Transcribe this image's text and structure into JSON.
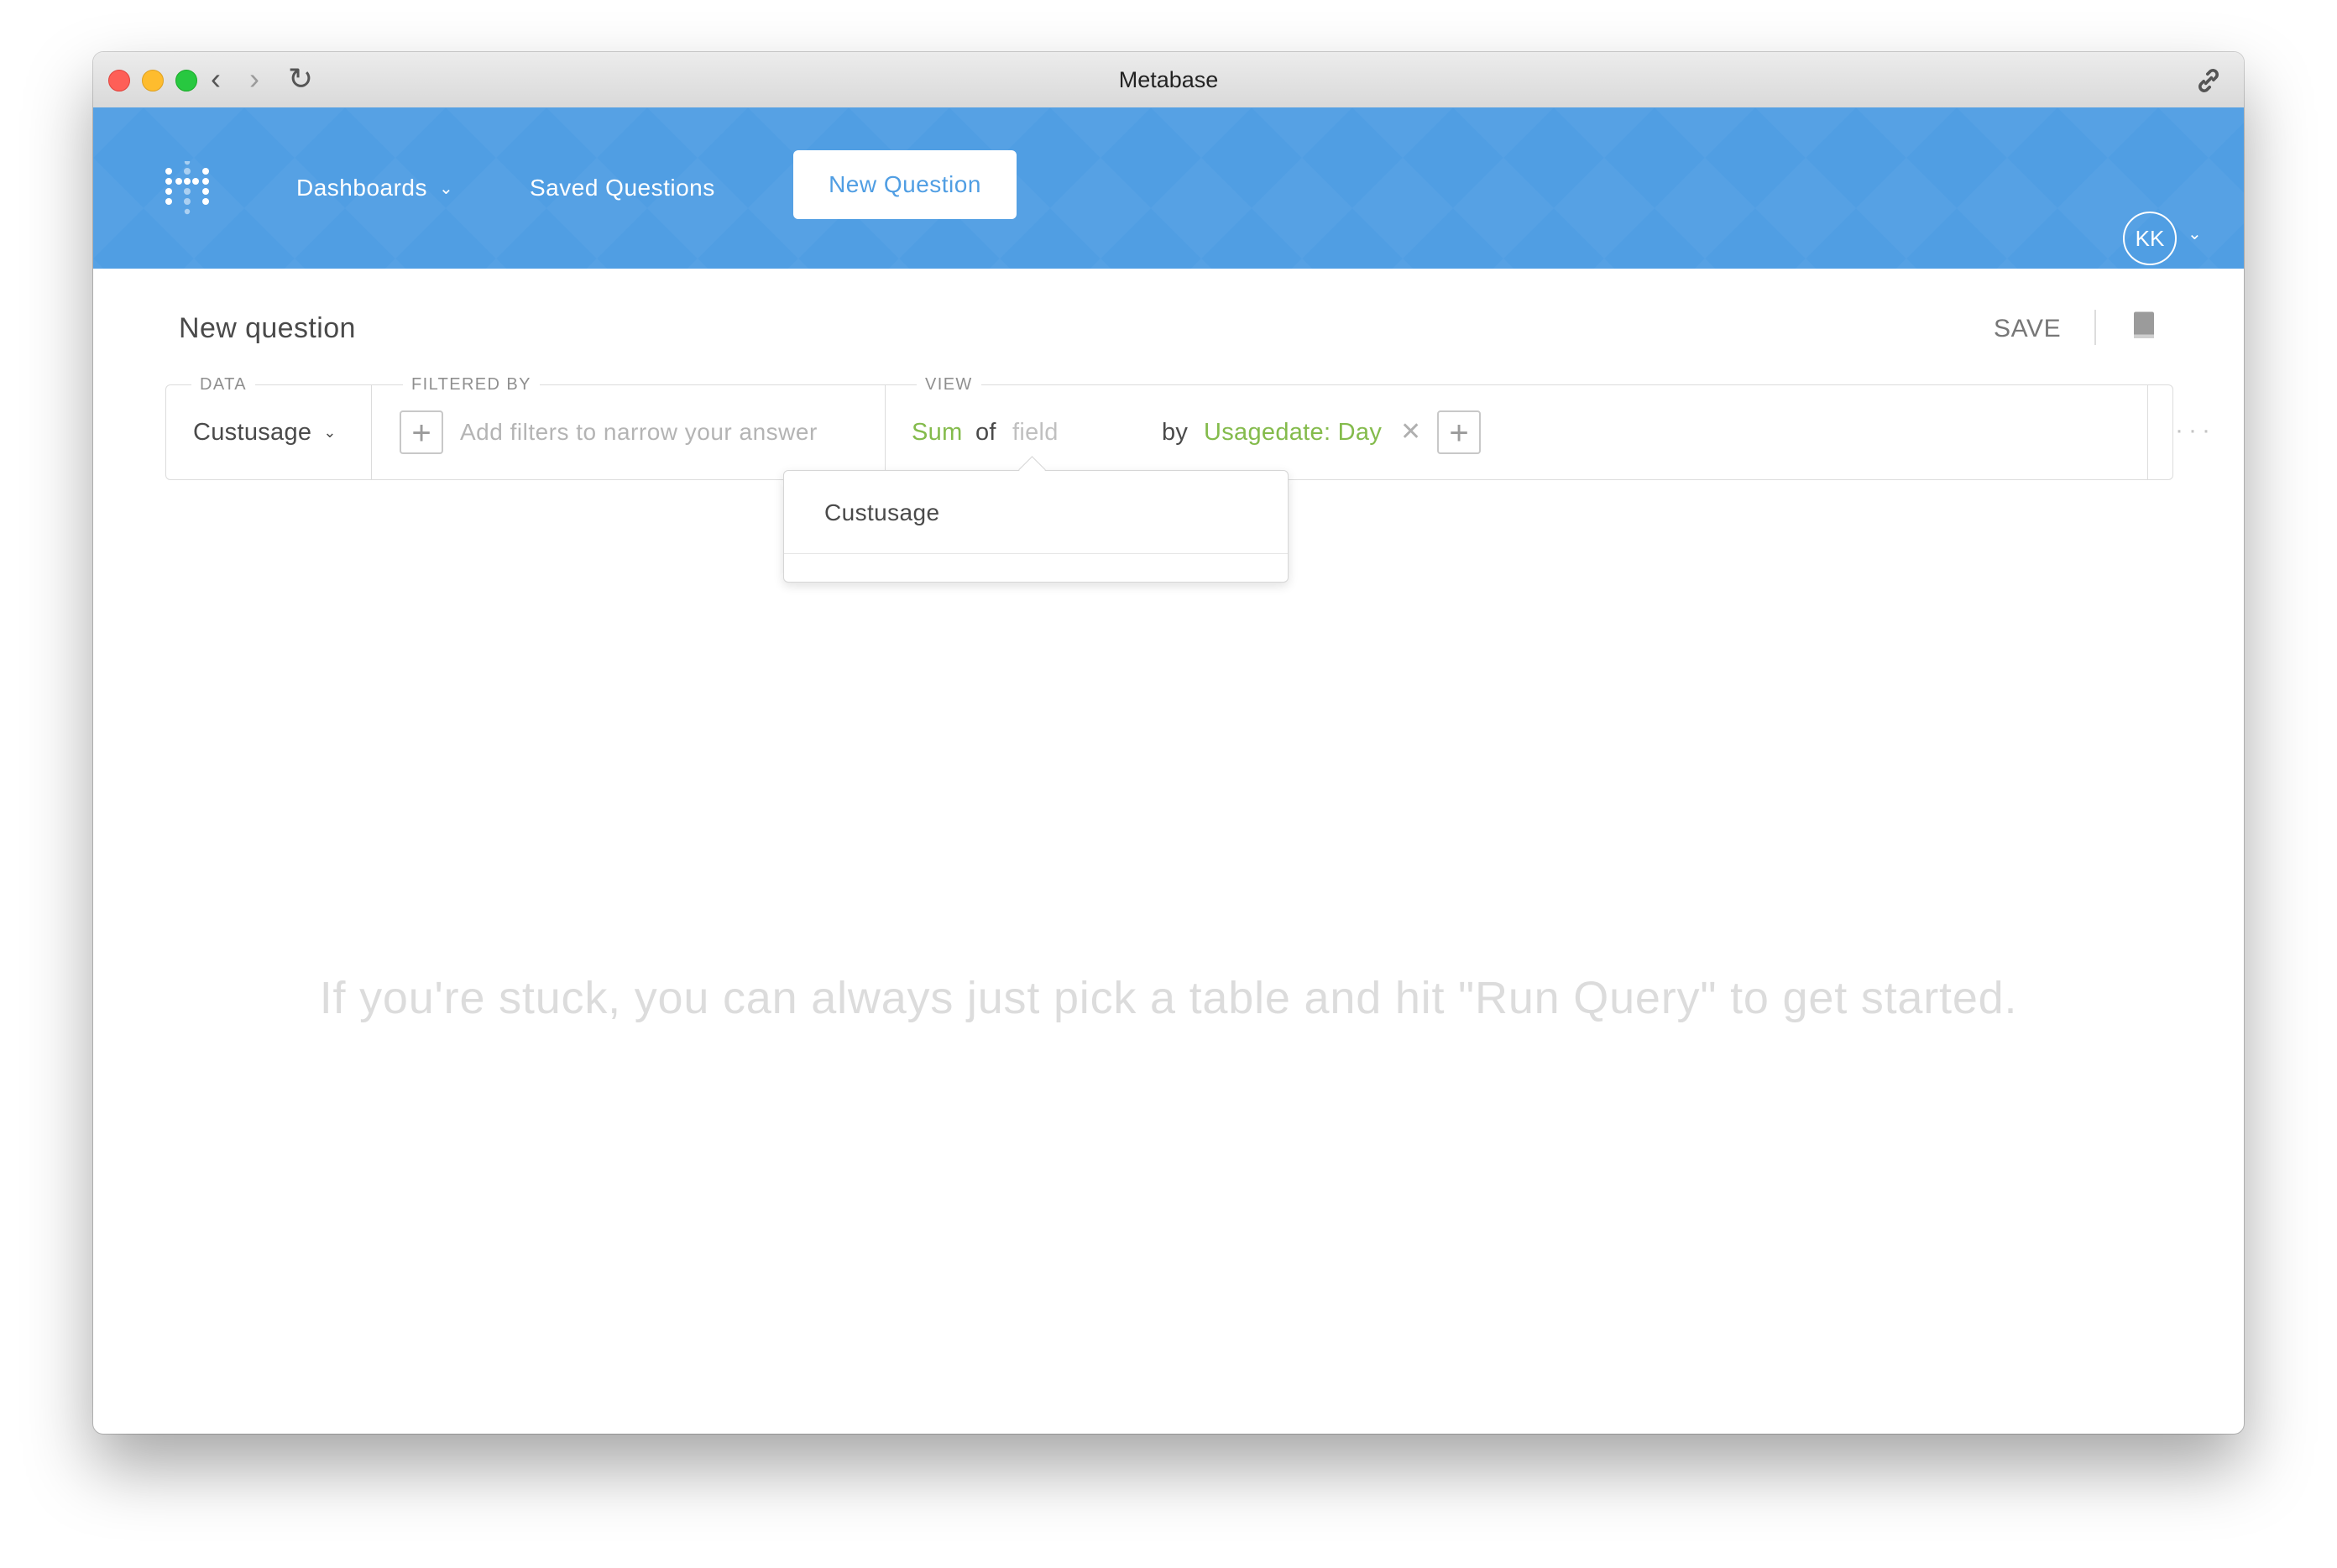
{
  "browser": {
    "window_title": "Metabase",
    "back_glyph": "‹",
    "forward_glyph": "›",
    "reload_glyph": "↻"
  },
  "nav": {
    "dashboards_label": "Dashboards",
    "saved_questions_label": "Saved Questions",
    "new_question_label": "New Question",
    "avatar_initials": "KK"
  },
  "question": {
    "title": "New question",
    "save_label": "SAVE"
  },
  "query": {
    "data_label": "DATA",
    "filtered_by_label": "FILTERED BY",
    "view_label": "VIEW",
    "data_source": "Custusage",
    "filter_placeholder": "Add filters to narrow your answer",
    "aggregation": "Sum",
    "of_word": "of",
    "field_placeholder": "field",
    "by_word": "by",
    "breakout": "Usagedate: Day",
    "remove_glyph": "✕",
    "more_glyph": "···"
  },
  "dropdown": {
    "items": [
      "Custusage"
    ]
  },
  "empty_state": {
    "hint": "If you're stuck, you can always just pick a table and hit \"Run Query\" to get started."
  },
  "colors": {
    "brand_blue": "#509ee3",
    "accent_green": "#84bb4c"
  },
  "icons": [
    "back-icon",
    "forward-icon",
    "reload-icon",
    "link-icon",
    "metabase-logo",
    "chevron-down-icon",
    "book-icon",
    "plus-icon",
    "close-icon",
    "ellipsis-icon"
  ]
}
